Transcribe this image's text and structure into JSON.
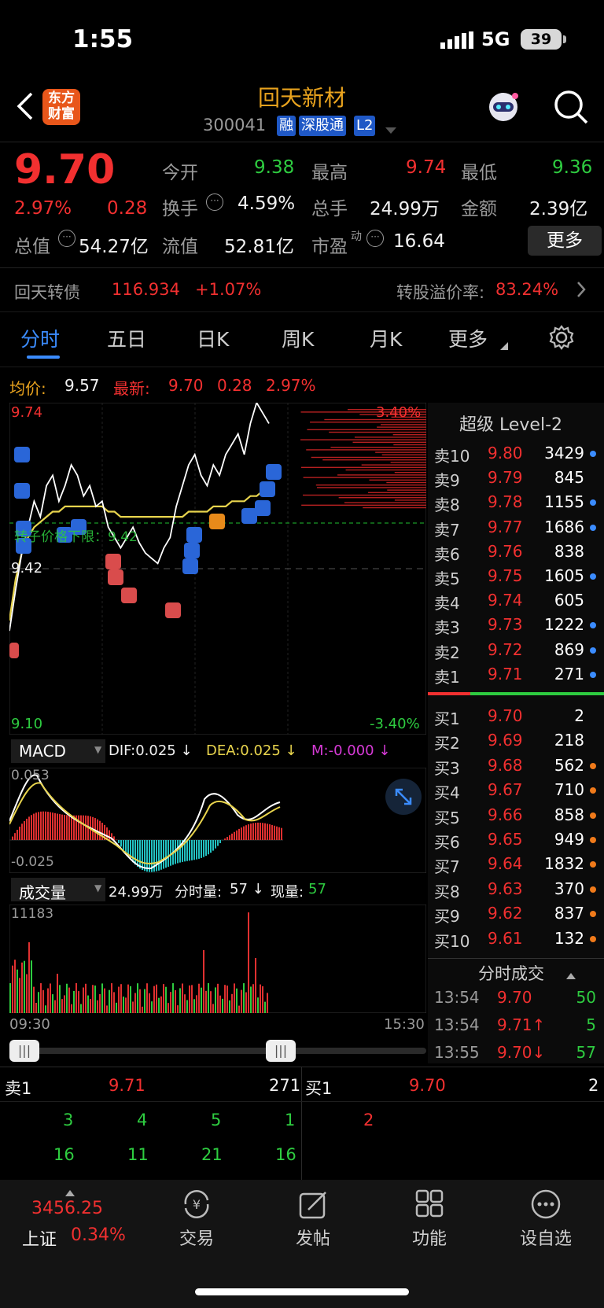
{
  "status": {
    "time": "1:55",
    "network": "5G",
    "battery": "39"
  },
  "header": {
    "logo_line1": "东方",
    "logo_line2": "财富",
    "name": "回天新材",
    "code": "300041",
    "badges": [
      "融",
      "深股通",
      "L2"
    ]
  },
  "quote": {
    "price": "9.70",
    "change_pct": "2.97%",
    "change": "0.28",
    "open_label": "今开",
    "open": "9.38",
    "high_label": "最高",
    "high": "9.74",
    "low_label": "最低",
    "low": "9.36",
    "turnover_label": "换手",
    "turnover": "4.59%",
    "total_hands_label": "总手",
    "total_hands": "24.99万",
    "amount_label": "金额",
    "amount": "2.39亿",
    "market_cap_label": "总值",
    "market_cap": "54.27亿",
    "float_cap_label": "流值",
    "float_cap": "52.81亿",
    "pe_label": "市盈",
    "pe_sup": "动",
    "pe": "16.64",
    "more_button": "更多"
  },
  "bond": {
    "name": "回天转债",
    "price": "116.934",
    "change": "+1.07%",
    "premium_label": "转股溢价率:",
    "premium": "83.24%"
  },
  "tabs": [
    "分时",
    "五日",
    "日K",
    "周K",
    "月K",
    "更多"
  ],
  "chart_info": {
    "avg_label": "均价:",
    "avg": "9.57",
    "latest_label": "最新:",
    "latest": "9.70",
    "change": "0.28",
    "change_pct": "2.97%",
    "y_top": "9.74",
    "y_mid": "9.42",
    "y_bottom": "9.10",
    "pct_top": "3.40%",
    "pct_bottom": "-3.40%",
    "limit_text": "转子价格下限：9.42"
  },
  "chart_data": {
    "type": "line",
    "title": "",
    "x_range": [
      "09:30",
      "15:30"
    ],
    "ylim": [
      9.1,
      9.74
    ],
    "series": [
      {
        "name": "最新",
        "values": [
          9.3,
          9.38,
          9.45,
          9.5,
          9.55,
          9.52,
          9.58,
          9.6,
          9.55,
          9.58,
          9.62,
          9.6,
          9.56,
          9.58,
          9.54,
          9.55,
          9.5,
          9.48,
          9.46,
          9.48,
          9.5,
          9.47,
          9.45,
          9.44,
          9.43,
          9.46,
          9.48,
          9.54,
          9.58,
          9.62,
          9.64,
          9.6,
          9.58,
          9.62,
          9.6,
          9.64,
          9.66,
          9.68,
          9.64,
          9.7,
          9.74,
          9.72,
          9.7
        ]
      },
      {
        "name": "均价",
        "values": [
          9.32,
          9.4,
          9.45,
          9.48,
          9.5,
          9.51,
          9.52,
          9.53,
          9.53,
          9.54,
          9.54,
          9.54,
          9.54,
          9.54,
          9.54,
          9.54,
          9.53,
          9.53,
          9.52,
          9.52,
          9.52,
          9.52,
          9.52,
          9.52,
          9.52,
          9.52,
          9.52,
          9.52,
          9.52,
          9.53,
          9.53,
          9.53,
          9.53,
          9.54,
          9.54,
          9.54,
          9.55,
          9.55,
          9.55,
          9.56,
          9.56,
          9.57,
          9.57
        ]
      }
    ],
    "macd": {
      "label": "MACD",
      "dif_label": "DIF:",
      "dif": "0.025",
      "dea_label": "DEA:",
      "dea": "0.025",
      "m_label": "M:",
      "m": "-0.000",
      "max": "0.053",
      "min": "-0.025"
    },
    "volume": {
      "label": "成交量",
      "total": "24.99万",
      "tick_label": "分时量:",
      "tick": "57",
      "now_label": "现量:",
      "now": "57",
      "max": "11183"
    },
    "time_start": "09:30",
    "time_end": "15:30"
  },
  "orderbook": {
    "title": "超级 Level-2",
    "asks": [
      {
        "label": "卖10",
        "price": "9.80",
        "vol": "3429"
      },
      {
        "label": "卖9",
        "price": "9.79",
        "vol": "845"
      },
      {
        "label": "卖8",
        "price": "9.78",
        "vol": "1155"
      },
      {
        "label": "卖7",
        "price": "9.77",
        "vol": "1686"
      },
      {
        "label": "卖6",
        "price": "9.76",
        "vol": "838"
      },
      {
        "label": "卖5",
        "price": "9.75",
        "vol": "1605"
      },
      {
        "label": "卖4",
        "price": "9.74",
        "vol": "605"
      },
      {
        "label": "卖3",
        "price": "9.73",
        "vol": "1222"
      },
      {
        "label": "卖2",
        "price": "9.72",
        "vol": "869"
      },
      {
        "label": "卖1",
        "price": "9.71",
        "vol": "271"
      }
    ],
    "bids": [
      {
        "label": "买1",
        "price": "9.70",
        "vol": "2"
      },
      {
        "label": "买2",
        "price": "9.69",
        "vol": "218"
      },
      {
        "label": "买3",
        "price": "9.68",
        "vol": "562"
      },
      {
        "label": "买4",
        "price": "9.67",
        "vol": "710"
      },
      {
        "label": "买5",
        "price": "9.66",
        "vol": "858"
      },
      {
        "label": "买6",
        "price": "9.65",
        "vol": "949"
      },
      {
        "label": "买7",
        "price": "9.64",
        "vol": "1832"
      },
      {
        "label": "买8",
        "price": "9.63",
        "vol": "370"
      },
      {
        "label": "买9",
        "price": "9.62",
        "vol": "837"
      },
      {
        "label": "买10",
        "price": "9.61",
        "vol": "132"
      }
    ],
    "ticks_title": "分时成交",
    "ticks": [
      {
        "time": "13:54",
        "price": "9.70",
        "vol": "50"
      },
      {
        "time": "13:54",
        "price": "9.71↑",
        "vol": "5"
      },
      {
        "time": "13:55",
        "price": "9.70↓",
        "vol": "57"
      }
    ]
  },
  "queue": {
    "ask_label": "卖1",
    "ask_price": "9.71",
    "ask_vol": "271",
    "bid_label": "买1",
    "bid_price": "9.70",
    "bid_vol": "2",
    "ask_row1": [
      "3",
      "4",
      "5",
      "1"
    ],
    "ask_row2": [
      "16",
      "11",
      "21",
      "16"
    ],
    "bid_row1": [
      "2"
    ]
  },
  "bottom_nav": {
    "index_value": "3456.25",
    "index_name": "上证",
    "index_change": "0.34%",
    "items": [
      "交易",
      "发帖",
      "功能",
      "设自选"
    ]
  },
  "colors": {
    "up": "#f23030",
    "down": "#2ecc40",
    "accent": "#e9a31e",
    "tab_active": "#3b8cff"
  }
}
